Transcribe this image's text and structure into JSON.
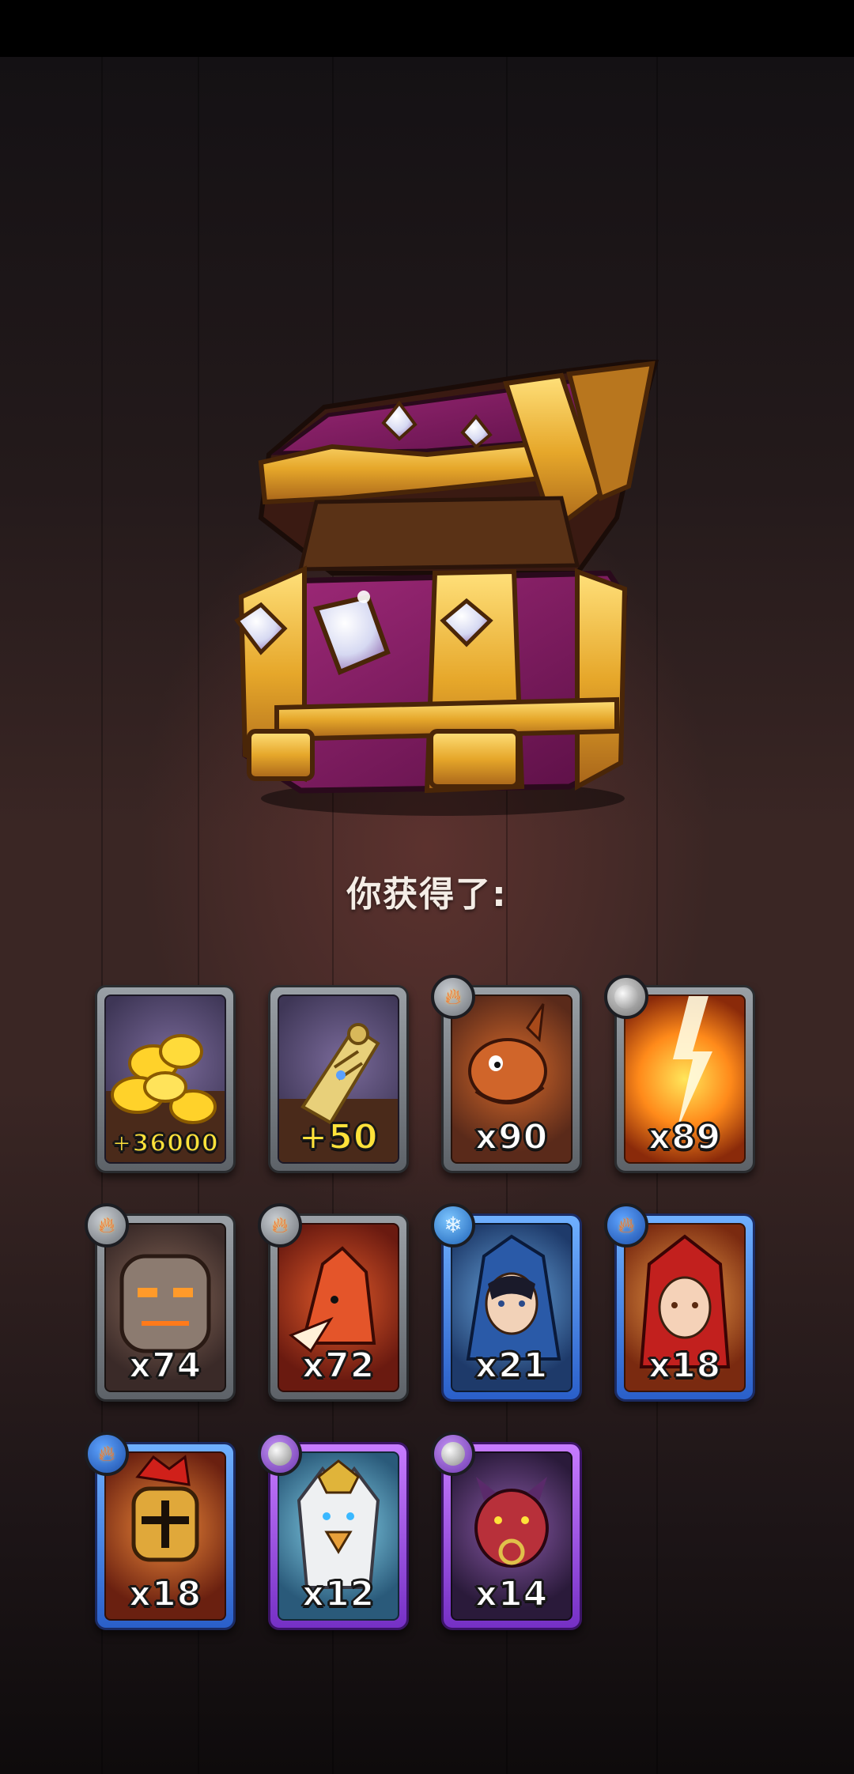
{
  "title": "你获得了:",
  "rewards": [
    {
      "id": "gold",
      "label": "+36000",
      "frame": "gray",
      "element": null
    },
    {
      "id": "scroll",
      "label": "+50",
      "frame": "gray",
      "element": null
    },
    {
      "id": "dragon",
      "label": "x90",
      "frame": "gray",
      "element": "fire"
    },
    {
      "id": "lightning",
      "label": "x89",
      "frame": "gray",
      "element": "earth"
    },
    {
      "id": "golem",
      "label": "x74",
      "frame": "gray",
      "element": "fire"
    },
    {
      "id": "fire-fox",
      "label": "x72",
      "frame": "gray",
      "element": "fire"
    },
    {
      "id": "ice-mage",
      "label": "x21",
      "frame": "blue",
      "element": "ice"
    },
    {
      "id": "red-hood",
      "label": "x18",
      "frame": "blue",
      "element": "fire"
    },
    {
      "id": "knight",
      "label": "x18",
      "frame": "blue",
      "element": "fire"
    },
    {
      "id": "griffin",
      "label": "x12",
      "frame": "purple",
      "element": "earth"
    },
    {
      "id": "boar-demon",
      "label": "x14",
      "frame": "purple",
      "element": "earth"
    }
  ],
  "colors": {
    "fire": "#ff6a1a",
    "ice": "#7dc6ff",
    "gold_text": "#ffe23a"
  }
}
